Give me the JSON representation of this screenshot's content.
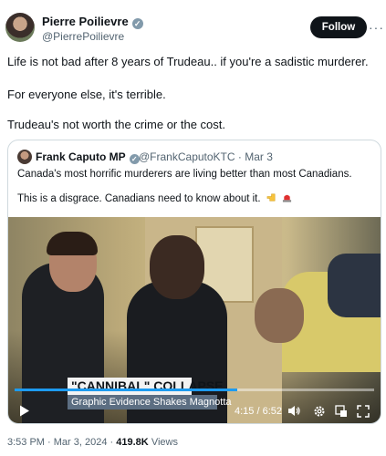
{
  "post": {
    "author_name": "Pierre Poilievre",
    "author_handle": "@PierrePoilievre",
    "follow_label": "Follow",
    "more_label": "···",
    "lines": [
      "Life is not bad after 8 years of Trudeau.. if you're a sadistic murderer.",
      "For everyone else, it's terrible.",
      "Trudeau's not worth the crime or the cost."
    ]
  },
  "quote": {
    "author_name": "Frank Caputo MP",
    "author_handle": "@FrankCaputoKTC",
    "separator": "·",
    "date": "Mar 3",
    "lines": [
      "Canada's most horrific murderers are living better than most Canadians.",
      "This is a disgrace. Canadians need to know about it."
    ],
    "video": {
      "headline": "\"CANNIBAL\" COLLAPSE",
      "subheadline": "Graphic Evidence Shakes Magnotta",
      "current_time": "4:15",
      "duration": "6:52",
      "time_display": "4:15 / 6:52",
      "progress": 0.62
    }
  },
  "footer": {
    "time": "3:53 PM",
    "date": "Mar 3, 2024",
    "separator": "·",
    "views_count": "419.8K",
    "views_label": "Views"
  },
  "colors": {
    "verified_badge": "#829aab",
    "follow_button": "#0f1419",
    "progress": "#1d9bf0"
  },
  "icons": [
    "avatar",
    "verified-badge-icon",
    "more-icon",
    "point-left-emoji-icon",
    "alarm-light-emoji-icon",
    "play-icon",
    "volume-icon",
    "settings-icon",
    "miniplayer-icon",
    "fullscreen-icon"
  ]
}
